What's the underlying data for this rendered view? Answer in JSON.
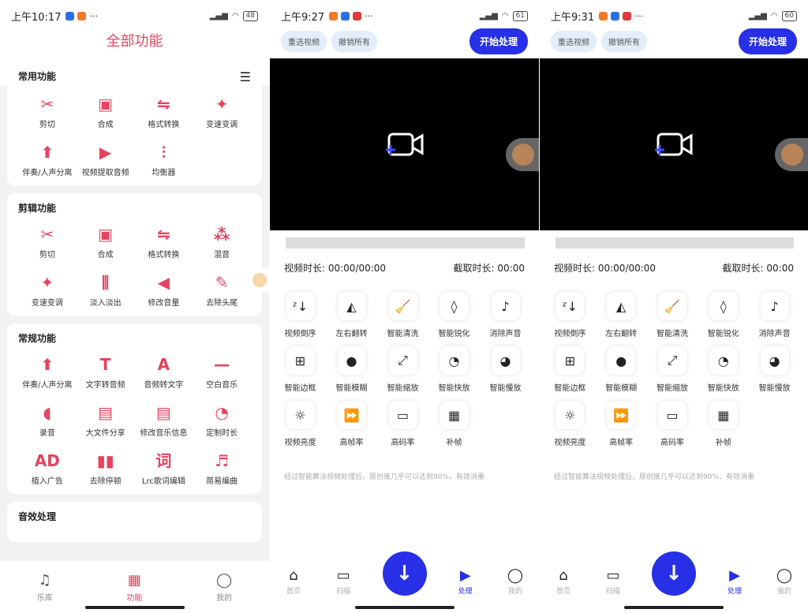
{
  "colors": {
    "pink": "#e5435f",
    "blue": "#2730e6"
  },
  "p1": {
    "status": {
      "time": "上午10:17",
      "battery": "48"
    },
    "title": "全部功能",
    "sections": [
      {
        "title": "常用功能",
        "items": [
          {
            "label": "剪切",
            "icon": "✂"
          },
          {
            "label": "合成",
            "icon": "▣"
          },
          {
            "label": "格式转换",
            "icon": "⇋"
          },
          {
            "label": "变速变调",
            "icon": "✦"
          },
          {
            "label": "伴奏/人声分离",
            "icon": "⬆"
          },
          {
            "label": "视频提取音频",
            "icon": "▶"
          },
          {
            "label": "均衡器",
            "icon": "⫶"
          }
        ]
      },
      {
        "title": "剪辑功能",
        "items": [
          {
            "label": "剪切",
            "icon": "✂"
          },
          {
            "label": "合成",
            "icon": "▣"
          },
          {
            "label": "格式转换",
            "icon": "⇋"
          },
          {
            "label": "混音",
            "icon": "⁂"
          },
          {
            "label": "变速变调",
            "icon": "✦"
          },
          {
            "label": "淡入淡出",
            "icon": "⫼"
          },
          {
            "label": "修改音量",
            "icon": "◀"
          },
          {
            "label": "去除头尾",
            "icon": "✎"
          }
        ]
      },
      {
        "title": "常规功能",
        "items": [
          {
            "label": "伴奏/人声分离",
            "icon": "⬆"
          },
          {
            "label": "文字转音频",
            "icon": "T"
          },
          {
            "label": "音频转文字",
            "icon": "A"
          },
          {
            "label": "空白音乐",
            "icon": "—"
          },
          {
            "label": "录音",
            "icon": "◖"
          },
          {
            "label": "大文件分享",
            "icon": "▤"
          },
          {
            "label": "修改音乐信息",
            "icon": "▤"
          },
          {
            "label": "定制时长",
            "icon": "◔"
          },
          {
            "label": "植入广告",
            "icon": "AD"
          },
          {
            "label": "去除停顿",
            "icon": "▮▮"
          },
          {
            "label": "Lrc歌词编辑",
            "icon": "词"
          },
          {
            "label": "简易编曲",
            "icon": "♬"
          }
        ]
      },
      {
        "title": "音效处理",
        "items": []
      }
    ],
    "tabs": [
      {
        "label": "乐库",
        "icon": "♫"
      },
      {
        "label": "功能",
        "icon": "▦"
      },
      {
        "label": "我的",
        "icon": "◯"
      }
    ]
  },
  "p2": {
    "status": {
      "time": "上午9:27",
      "battery": "61"
    },
    "reselect": "重选视频",
    "undo": "撤销所有",
    "start": "开始处理",
    "duration": "视频时长: 00:00/00:00",
    "clip": "截取时长: 00:00",
    "tools": [
      {
        "label": "视频倒序",
        "icon": "ᶻ↓"
      },
      {
        "label": "左右翻转",
        "icon": "◭"
      },
      {
        "label": "智能清洗",
        "icon": "🧹"
      },
      {
        "label": "智能锐化",
        "icon": "◊"
      },
      {
        "label": "消除声音",
        "icon": "♪"
      },
      {
        "label": "智能边框",
        "icon": "⊞"
      },
      {
        "label": "智能模糊",
        "icon": "●"
      },
      {
        "label": "智能缩放",
        "icon": "⤢"
      },
      {
        "label": "智能快放",
        "icon": "◔"
      },
      {
        "label": "智能慢放",
        "icon": "◕"
      },
      {
        "label": "视频亮度",
        "icon": "☼"
      },
      {
        "label": "高帧率",
        "icon": "⏩"
      },
      {
        "label": "高码率",
        "icon": "▭"
      },
      {
        "label": "补帧",
        "icon": "▦"
      }
    ],
    "note": "经过智能算法视频处理后，原创度几乎可以达到90%，有效消重",
    "tabs": [
      {
        "label": "首页",
        "icon": "⌂"
      },
      {
        "label": "扫描",
        "icon": "▭"
      },
      {
        "label": "处理",
        "icon": "▶"
      },
      {
        "label": "我的",
        "icon": "◯"
      }
    ]
  },
  "p3": {
    "status": {
      "time": "上午9:31",
      "battery": "60"
    },
    "reselect": "重选视频",
    "undo": "撤销所有",
    "start": "开始处理",
    "duration": "视频时长: 00:00/00:00",
    "clip": "截取时长: 00:00",
    "tools": [
      {
        "label": "视频倒序",
        "icon": "ᶻ↓"
      },
      {
        "label": "左右翻转",
        "icon": "◭"
      },
      {
        "label": "智能清洗",
        "icon": "🧹"
      },
      {
        "label": "智能锐化",
        "icon": "◊"
      },
      {
        "label": "消除声音",
        "icon": "♪"
      },
      {
        "label": "智能边框",
        "icon": "⊞"
      },
      {
        "label": "智能模糊",
        "icon": "●"
      },
      {
        "label": "智能缩放",
        "icon": "⤢"
      },
      {
        "label": "智能快放",
        "icon": "◔"
      },
      {
        "label": "智能慢放",
        "icon": "◕"
      },
      {
        "label": "视频亮度",
        "icon": "☼"
      },
      {
        "label": "高帧率",
        "icon": "⏩"
      },
      {
        "label": "高码率",
        "icon": "▭"
      },
      {
        "label": "补帧",
        "icon": "▦"
      }
    ],
    "note": "经过智能算法视频处理后，原创度几乎可以达到90%，有效消重",
    "tabs": [
      {
        "label": "首页",
        "icon": "⌂"
      },
      {
        "label": "扫描",
        "icon": "▭"
      },
      {
        "label": "处理",
        "icon": "▶"
      },
      {
        "label": "我的",
        "icon": "◯"
      }
    ]
  }
}
